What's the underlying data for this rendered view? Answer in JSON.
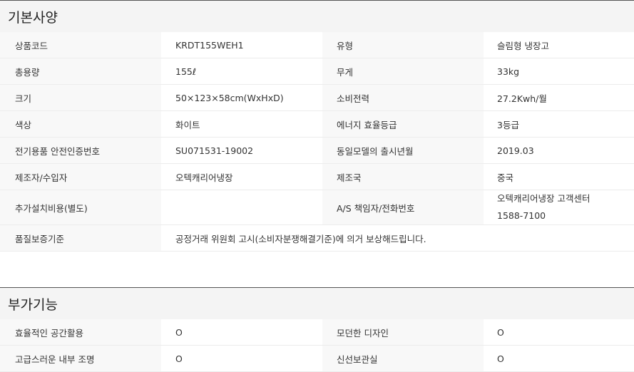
{
  "basic_spec": {
    "title": "기본사양",
    "rows": [
      {
        "l1": "상품코드",
        "v1": "KRDT155WEH1",
        "l2": "유형",
        "v2": "슬림형 냉장고"
      },
      {
        "l1": "총용량",
        "v1": "155ℓ",
        "l2": "무게",
        "v2": "33kg"
      },
      {
        "l1": "크기",
        "v1": "50×123×58cm(WxHxD)",
        "l2": "소비전력",
        "v2": "27.2Kwh/월"
      },
      {
        "l1": "색상",
        "v1": "화이트",
        "l2": "에너지 효율등급",
        "v2": "3등급"
      },
      {
        "l1": "전기용품 안전인증번호",
        "v1": "SU071531-19002",
        "l2": "동일모델의 출시년월",
        "v2": "2019.03"
      },
      {
        "l1": "제조자/수입자",
        "v1": "오텍캐리어냉장",
        "l2": "제조국",
        "v2": "중국"
      }
    ],
    "as_row": {
      "l1": "추가설치비용(별도)",
      "v1": "",
      "l2": "A/S 책임자/전화번호",
      "v2_line1": "오텍캐리어냉장 고객센터",
      "v2_line2": "1588-7100"
    },
    "warranty_row": {
      "label": "품질보증기준",
      "value": "공정거래 위원회 고시(소비자분쟁해결기준)에 의거 보상해드립니다."
    }
  },
  "extra_features": {
    "title": "부가기능",
    "rows": [
      {
        "l1": "효율적인 공간활용",
        "v1": "O",
        "l2": "모던한 디자인",
        "v2": "O"
      },
      {
        "l1": "고급스러운 내부 조명",
        "v1": "O",
        "l2": "신선보관실",
        "v2": "O"
      }
    ]
  }
}
